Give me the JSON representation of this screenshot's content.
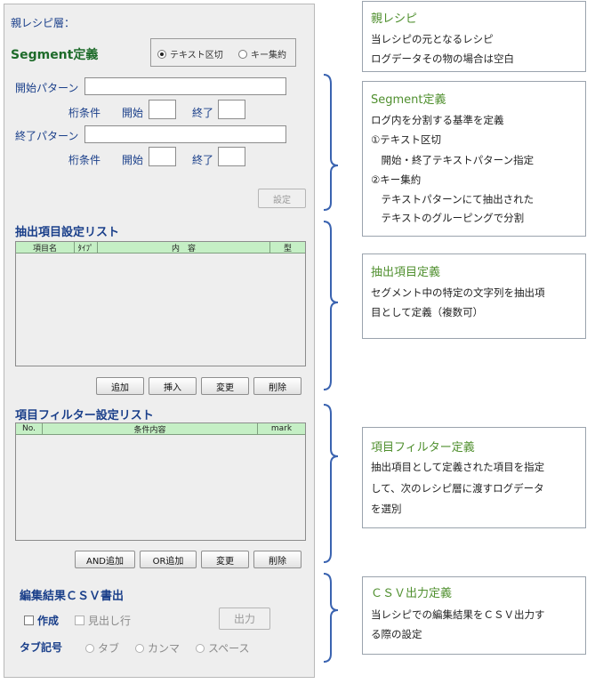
{
  "parent": {
    "label": "親レシピ層："
  },
  "segment": {
    "title": "Segment定義",
    "radio_text": "テキスト区切",
    "radio_key": "キー集約",
    "start_label": "開始パターン",
    "end_label": "終了パターン",
    "digit_label": "桁条件",
    "begin_label": "開始",
    "finish_label": "終了",
    "set_button": "設定"
  },
  "extract_list": {
    "title": "抽出項目設定リスト",
    "columns": [
      "項目名",
      "ﾀｲﾌﾟ",
      "内　容",
      "型"
    ],
    "buttons": [
      "追加",
      "挿入",
      "変更",
      "削除"
    ]
  },
  "filter_list": {
    "title": "項目フィルター設定リスト",
    "columns": [
      "No.",
      "条件内容",
      "mark"
    ],
    "buttons": [
      "AND追加",
      "OR追加",
      "変更",
      "削除"
    ]
  },
  "csv": {
    "title": "編集結果ＣＳＶ書出",
    "create_label": "作成",
    "header_label": "見出し行",
    "output_button": "出力",
    "tab_label": "タブ記号",
    "tab_options": [
      "タブ",
      "カンマ",
      "スペース"
    ]
  },
  "notes": [
    {
      "title": "親レシピ",
      "lines": [
        "当レシピの元となるレシピ",
        "ログデータその物の場合は空白"
      ]
    },
    {
      "title": "Segment定義",
      "lines": [
        "ログ内を分割する基準を定義",
        "①テキスト区切",
        "　開始・終了テキストパターン指定",
        "②キー集約",
        "　テキストパターンにて抽出された",
        "　テキストのグルーピングで分割"
      ]
    },
    {
      "title": "抽出項目定義",
      "lines": [
        "セグメント中の特定の文字列を抽出項",
        "目として定義（複数可）"
      ]
    },
    {
      "title": "項目フィルター定義",
      "lines": [
        "抽出項目として定義された項目を指定",
        "して、次のレシピ層に渡すログデータ",
        "を選別"
      ]
    },
    {
      "title": "ＣＳＶ出力定義",
      "lines": [
        "当レシピでの編集結果をＣＳＶ出力す",
        "る際の設定"
      ]
    }
  ],
  "colors": {
    "header_blue": "#1a3f8a",
    "segment_green": "#1e6b2a",
    "note_green": "#4f8f2e",
    "table_header": "#c5efc5",
    "bracket": "#3a63b0"
  }
}
